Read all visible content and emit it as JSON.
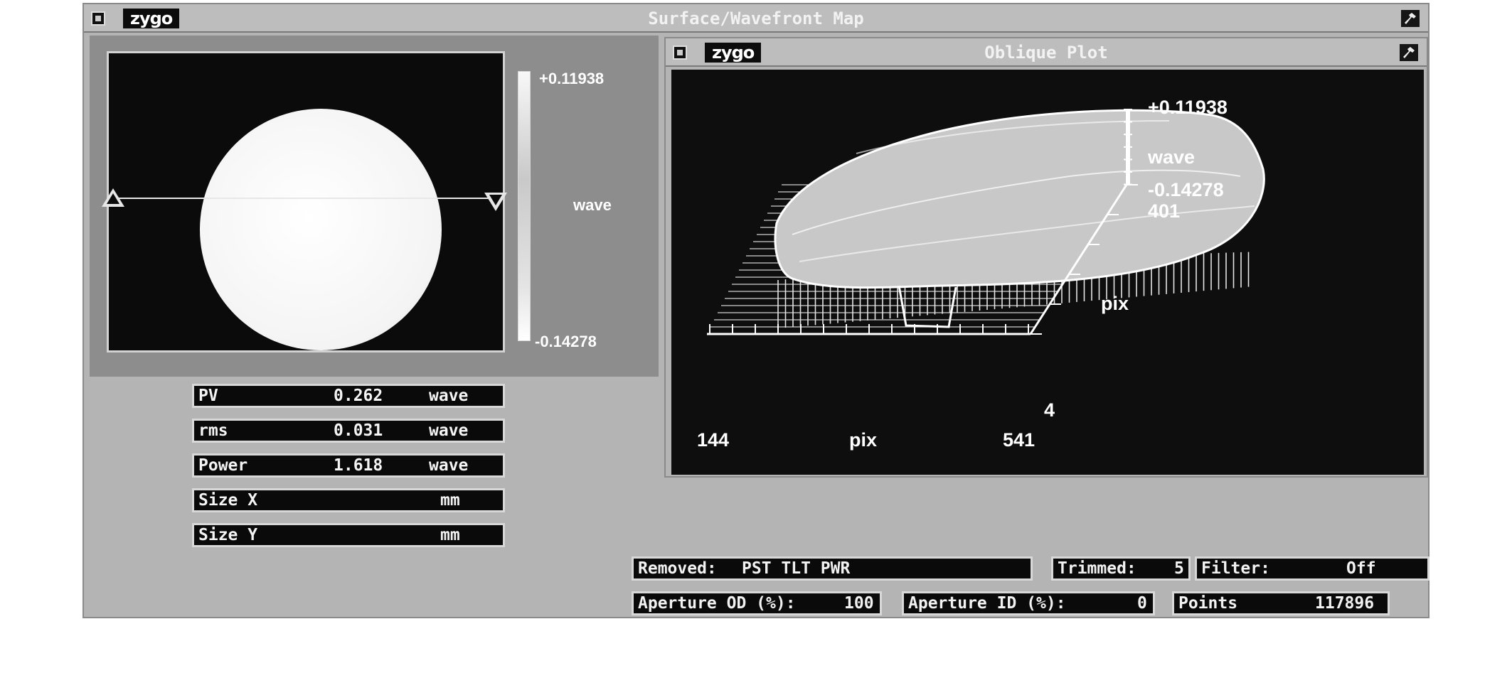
{
  "main_window": {
    "title": "Surface/Wavefront Map",
    "logo": "zygo"
  },
  "surface_map": {
    "scale_max": "+0.11938",
    "scale_min": "-0.14278",
    "scale_unit": "wave"
  },
  "stats": [
    {
      "label": "PV",
      "value": "0.262",
      "unit": "wave"
    },
    {
      "label": "rms",
      "value": "0.031",
      "unit": "wave"
    },
    {
      "label": "Power",
      "value": "1.618",
      "unit": "wave"
    },
    {
      "label": "Size X",
      "value": "",
      "unit": "mm"
    },
    {
      "label": "Size Y",
      "value": "",
      "unit": "mm"
    }
  ],
  "oblique_window": {
    "title": "Oblique Plot",
    "logo": "zygo",
    "scale_max": "+0.11938",
    "scale_unit": "wave",
    "scale_min": "-0.14278",
    "y_axis_max": "401",
    "y_axis_unit": "pix",
    "y_axis_min": "4",
    "x_axis_min": "144",
    "x_axis_unit": "pix",
    "x_axis_max": "541"
  },
  "status": {
    "removed_label": "Removed:",
    "removed_value": "PST TLT PWR",
    "trimmed_label": "Trimmed:",
    "trimmed_value": "5",
    "filter_label": "Filter:",
    "filter_value": "Off",
    "aperture_od_label": "Aperture OD (%):",
    "aperture_od_value": "100",
    "aperture_id_label": "Aperture ID (%):",
    "aperture_id_value": "0",
    "points_label": "Points",
    "points_value": "117896"
  }
}
